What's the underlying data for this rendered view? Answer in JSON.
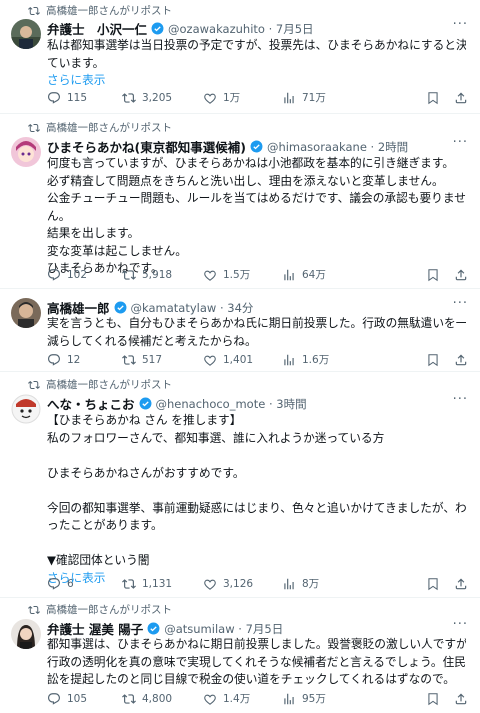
{
  "repost_label": "高橋雄一郎さんがリポスト",
  "more_glyph": "···",
  "tweets": [
    {
      "name": "弁護士　小沢一仁",
      "handle": "@ozawakazuhito · 7月5日",
      "lines": [
        "私は都知事選挙は当日投票の予定ですが、投票先は、ひまそらあかねにすると決め",
        "ています。"
      ],
      "show_more": "さらに表示",
      "replies": "115",
      "reposts": "3,205",
      "likes": "1万",
      "views": "71万"
    },
    {
      "name": "ひまそらあかね(東京都知事選候補)",
      "handle": "@himasoraakane · 2時間",
      "lines": [
        "何度も言っていますが、ひまそらあかねは小池都政を基本的に引き継ぎます。",
        "必ず精査して問題点をきちんと洗い出し、理由を添えないと変革しません。",
        "公金チューチュー問題も、ルールを当てはめるだけです、議会の承認も要りませ",
        "ん。",
        "結果を出します。",
        "変な変革は起こしません。",
        "ひまそらあかねです。"
      ],
      "replies": "102",
      "reposts": "5,918",
      "likes": "1.5万",
      "views": "64万"
    },
    {
      "name": "高橋雄一郎",
      "handle": "@kamatatylaw · 34分",
      "lines": [
        "実を言うとも、自分もひまそらあかね氏に期日前投票した。行政の無駄遣いを一番",
        "減らしてくれる候補だと考えたからね。"
      ],
      "replies": "12",
      "reposts": "517",
      "likes": "1,401",
      "views": "1.6万"
    },
    {
      "name": "へな・ちょこお",
      "handle": "@henachoco_mote · 3時間",
      "lines": [
        "【ひまそらあかね さん を推します】",
        "私のフォロワーさんで、都知事選、誰に入れようか迷っている方",
        "",
        "ひまそらあかねさんがおすすめです。",
        "",
        "今回の都知事選挙、事前運動疑惑にはじまり、色々と追いかけてきましたが、わか",
        "ったことがあります。",
        "",
        "▼確認団体という闇"
      ],
      "show_more": "さらに表示",
      "replies": "6",
      "reposts": "1,131",
      "likes": "3,126",
      "views": "8万"
    },
    {
      "name": "弁護士 渥美 陽子",
      "handle": "@atsumilaw · 7月5日",
      "lines": [
        "都知事選は、ひまそらあかねに期日前投票しました。毀誉褒貶の激しい人ですが、",
        "行政の透明化を真の意味で実現してくれそうな候補者だと言えるでしょう。住民訴",
        "訟を提起したのと同じ目線で税金の使い道をチェックしてくれるはずなので。"
      ],
      "replies": "105",
      "reposts": "4,800",
      "likes": "1.4万",
      "views": "95万"
    }
  ]
}
